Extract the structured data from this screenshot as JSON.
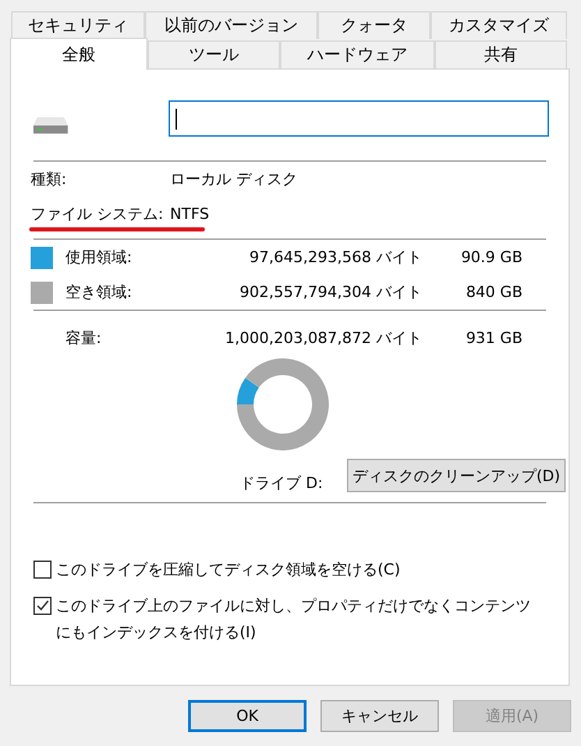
{
  "tabs_back": [
    {
      "label": "セキュリティ",
      "selected": false
    },
    {
      "label": "以前のバージョン",
      "selected": false
    },
    {
      "label": "クォータ",
      "selected": false
    },
    {
      "label": "カスタマイズ",
      "selected": false
    }
  ],
  "tabs_front": [
    {
      "label": "全般",
      "selected": true
    },
    {
      "label": "ツール",
      "selected": false
    },
    {
      "label": "ハードウェア",
      "selected": false
    },
    {
      "label": "共有",
      "selected": false
    }
  ],
  "info": [
    {
      "label": "種類:",
      "value": "ローカル ディスク"
    },
    {
      "label": "ファイル システム:",
      "value": "NTFS"
    }
  ],
  "usage": [
    {
      "label": "使用領域:",
      "bytes": "97,645,293,568 バイト",
      "size": "90.9 GB",
      "color": "#26a0da"
    },
    {
      "label": "空き領域:",
      "bytes": "902,557,794,304 バイト",
      "size": "840 GB",
      "color": "#aaaaaa"
    }
  ],
  "capacity": {
    "label": "容量:",
    "bytes": "1,000,203,087,872 バイト",
    "size": "931 GB"
  },
  "chart_data": {
    "type": "donut",
    "values": [
      9.8,
      90.2
    ]
  },
  "drive_label": "ドライブ D:",
  "cleanup_button": "ディスクのクリーンアップ(D)",
  "options": [
    {
      "label": "このドライブを圧縮してディスク領域を空ける(C)",
      "checked": false
    },
    {
      "label": "このドライブ上のファイルに対し、プロパティだけでなくコンテンツにもインデックスを付ける(I)",
      "checked": true
    }
  ],
  "buttons": [
    {
      "label": "OK",
      "kind": "default",
      "disabled": false
    },
    {
      "label": "キャンセル",
      "kind": "normal",
      "disabled": false
    },
    {
      "label": "適用(A)",
      "kind": "normal",
      "disabled": true
    }
  ]
}
